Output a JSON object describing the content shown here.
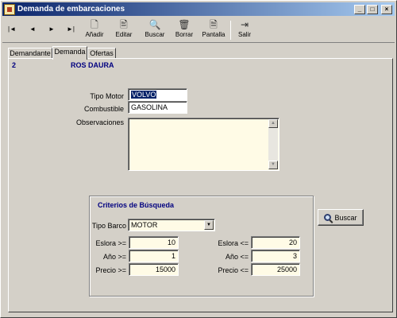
{
  "window": {
    "title": "Demanda de embarcaciones",
    "controls": [
      "_",
      "□",
      "×"
    ]
  },
  "toolbar": {
    "nav": [
      "|◄",
      "◄",
      "►",
      "►|"
    ],
    "buttons": [
      {
        "label": "Añadir",
        "icon": "new-document-icon",
        "glyph": "🗋"
      },
      {
        "label": "Editar",
        "icon": "edit-document-icon",
        "glyph": "🖹"
      },
      {
        "label": "Buscar",
        "icon": "search-icon",
        "glyph": "🔍"
      },
      {
        "label": "Borrar",
        "icon": "trash-icon",
        "glyph": "🗑"
      },
      {
        "label": "Pantalla",
        "icon": "print-preview-icon",
        "glyph": "🗎"
      },
      {
        "label": "Salir",
        "icon": "exit-door-icon",
        "glyph": "⇥"
      }
    ]
  },
  "tabs": [
    "Demandante",
    "Demanda",
    "Ofertas"
  ],
  "active_tab": "Demanda",
  "client": {
    "code": "2",
    "name": "ROS DAURA"
  },
  "form": {
    "tipo_motor_label": "Tipo Motor",
    "tipo_motor_value": "VOLVO",
    "combustible_label": "Combustible",
    "combustible_value": "GASOLINA",
    "observaciones_label": "Observaciones",
    "observaciones_value": ""
  },
  "criteria": {
    "title": "Criterios de Búsqueda",
    "tipo_barco_label": "Tipo Barco",
    "tipo_barco_value": "MOTOR",
    "eslora_min_label": "Eslora >=",
    "eslora_min": "10",
    "anio_min_label": "Año >=",
    "anio_min": "1",
    "precio_min_label": "Precio >=",
    "precio_min": "15000",
    "eslora_max_label": "Eslora <=",
    "eslora_max": "20",
    "anio_max_label": "Año <=",
    "anio_max": "3",
    "precio_max_label": "Precio <=",
    "precio_max": "25000"
  },
  "search_button": {
    "label": "Buscar",
    "icon": "search-icon"
  }
}
